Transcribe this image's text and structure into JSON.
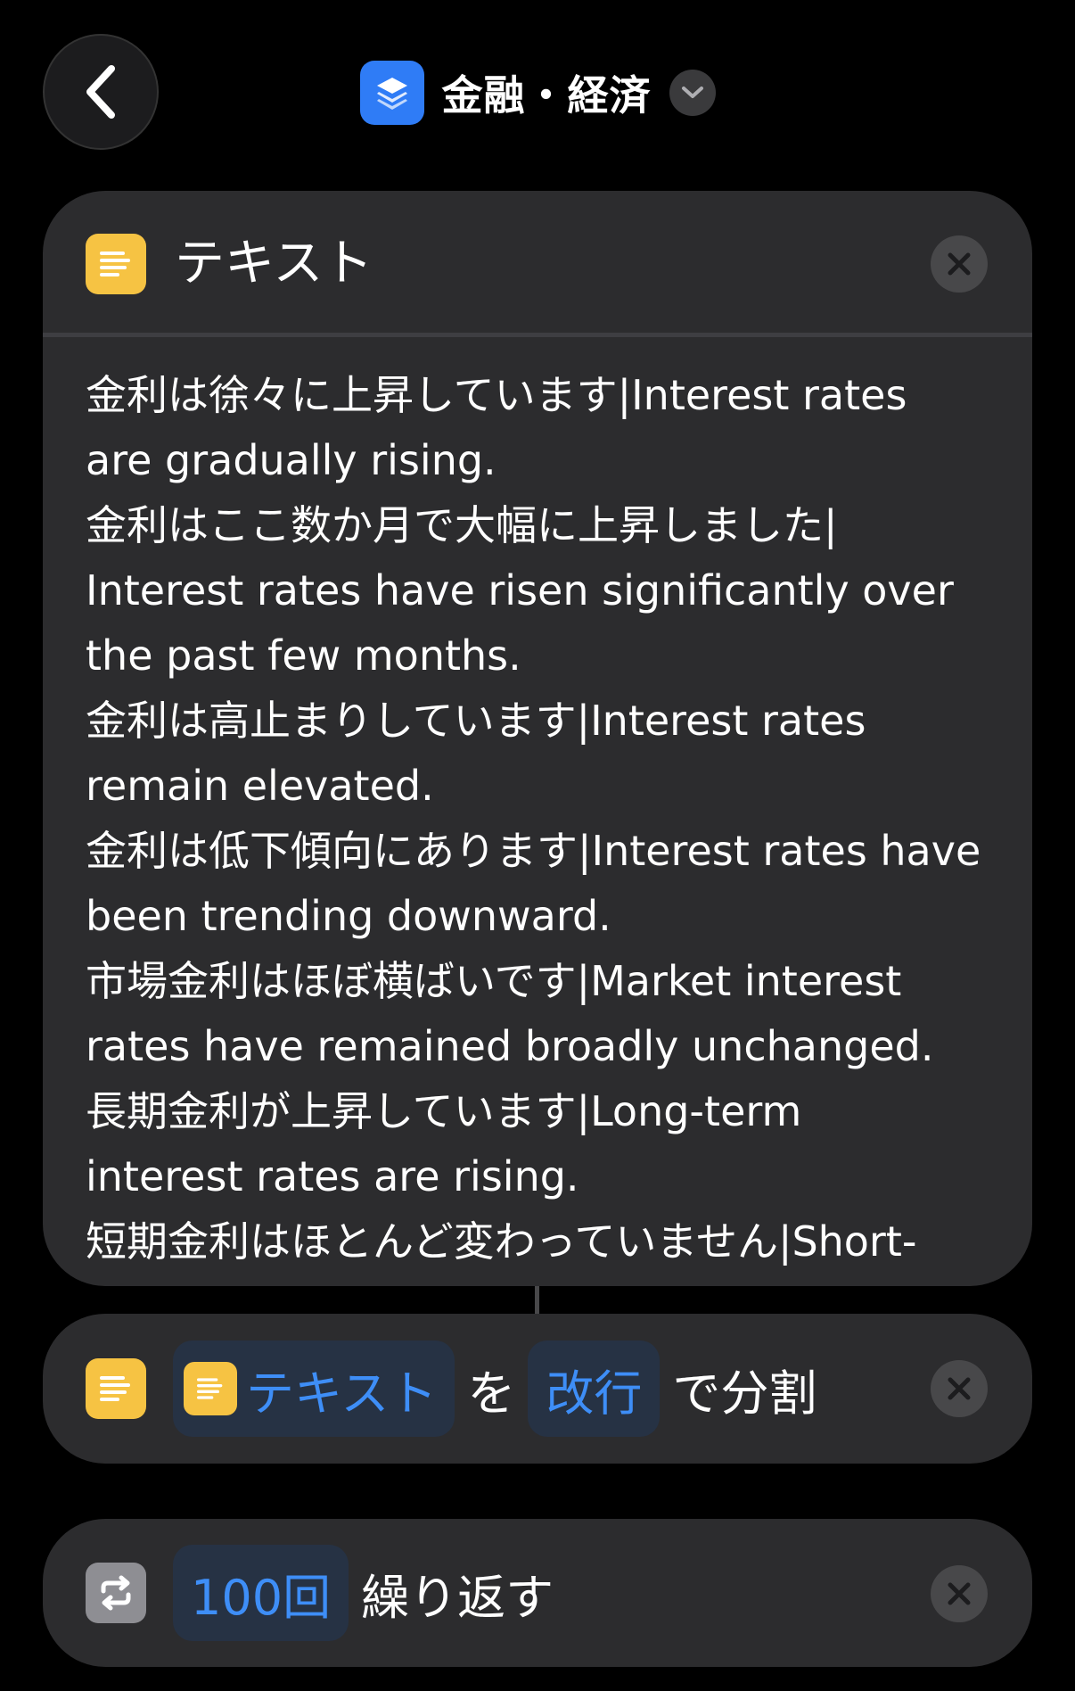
{
  "nav": {
    "back_icon": "chevron-left-icon",
    "title": "金融・経済",
    "app_icon": "stack-layers-icon",
    "title_dropdown_icon": "chevron-down-icon"
  },
  "text_action": {
    "header_label": "テキスト",
    "icon": "text-lines-icon",
    "content": "金利は徐々に上昇しています|Interest rates\nare gradually rising.\n金利はここ数か月で大幅に上昇しました|\nInterest rates have risen significantly over\nthe past few months.\n金利は高止まりしています|Interest rates\nremain elevated.\n金利は低下傾向にあります|Interest rates have\nbeen trending downward.\n市場金利はほぼ横ばいです|Market interest\nrates have remained broadly unchanged.\n長期金利が上昇しています|Long-term\ninterest rates are rising.\n短期金利はほとんど変わっていません|Short-"
  },
  "split_action": {
    "token_text": "テキスト",
    "connector_wo": "を",
    "separator_token": "改行",
    "suffix": "で分割"
  },
  "repeat_action": {
    "count_token": "100回",
    "suffix": "繰り返す",
    "icon": "repeat-arrows-icon"
  },
  "colors": {
    "background": "#000000",
    "card": "#2c2c2e",
    "accent_blue": "#3e8ef7",
    "text_icon_yellow": "#f6c343",
    "app_icon_blue": "#2f7cf6"
  }
}
